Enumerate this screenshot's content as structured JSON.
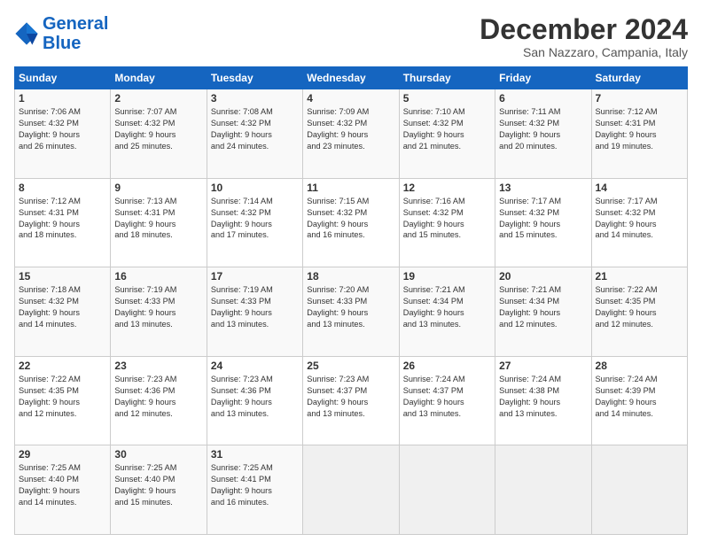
{
  "logo": {
    "line1": "General",
    "line2": "Blue"
  },
  "title": "December 2024",
  "subtitle": "San Nazzaro, Campania, Italy",
  "days_header": [
    "Sunday",
    "Monday",
    "Tuesday",
    "Wednesday",
    "Thursday",
    "Friday",
    "Saturday"
  ],
  "weeks": [
    [
      {
        "day": "1",
        "info": "Sunrise: 7:06 AM\nSunset: 4:32 PM\nDaylight: 9 hours\nand 26 minutes."
      },
      {
        "day": "2",
        "info": "Sunrise: 7:07 AM\nSunset: 4:32 PM\nDaylight: 9 hours\nand 25 minutes."
      },
      {
        "day": "3",
        "info": "Sunrise: 7:08 AM\nSunset: 4:32 PM\nDaylight: 9 hours\nand 24 minutes."
      },
      {
        "day": "4",
        "info": "Sunrise: 7:09 AM\nSunset: 4:32 PM\nDaylight: 9 hours\nand 23 minutes."
      },
      {
        "day": "5",
        "info": "Sunrise: 7:10 AM\nSunset: 4:32 PM\nDaylight: 9 hours\nand 21 minutes."
      },
      {
        "day": "6",
        "info": "Sunrise: 7:11 AM\nSunset: 4:32 PM\nDaylight: 9 hours\nand 20 minutes."
      },
      {
        "day": "7",
        "info": "Sunrise: 7:12 AM\nSunset: 4:31 PM\nDaylight: 9 hours\nand 19 minutes."
      }
    ],
    [
      {
        "day": "8",
        "info": "Sunrise: 7:12 AM\nSunset: 4:31 PM\nDaylight: 9 hours\nand 18 minutes."
      },
      {
        "day": "9",
        "info": "Sunrise: 7:13 AM\nSunset: 4:31 PM\nDaylight: 9 hours\nand 18 minutes."
      },
      {
        "day": "10",
        "info": "Sunrise: 7:14 AM\nSunset: 4:32 PM\nDaylight: 9 hours\nand 17 minutes."
      },
      {
        "day": "11",
        "info": "Sunrise: 7:15 AM\nSunset: 4:32 PM\nDaylight: 9 hours\nand 16 minutes."
      },
      {
        "day": "12",
        "info": "Sunrise: 7:16 AM\nSunset: 4:32 PM\nDaylight: 9 hours\nand 15 minutes."
      },
      {
        "day": "13",
        "info": "Sunrise: 7:17 AM\nSunset: 4:32 PM\nDaylight: 9 hours\nand 15 minutes."
      },
      {
        "day": "14",
        "info": "Sunrise: 7:17 AM\nSunset: 4:32 PM\nDaylight: 9 hours\nand 14 minutes."
      }
    ],
    [
      {
        "day": "15",
        "info": "Sunrise: 7:18 AM\nSunset: 4:32 PM\nDaylight: 9 hours\nand 14 minutes."
      },
      {
        "day": "16",
        "info": "Sunrise: 7:19 AM\nSunset: 4:33 PM\nDaylight: 9 hours\nand 13 minutes."
      },
      {
        "day": "17",
        "info": "Sunrise: 7:19 AM\nSunset: 4:33 PM\nDaylight: 9 hours\nand 13 minutes."
      },
      {
        "day": "18",
        "info": "Sunrise: 7:20 AM\nSunset: 4:33 PM\nDaylight: 9 hours\nand 13 minutes."
      },
      {
        "day": "19",
        "info": "Sunrise: 7:21 AM\nSunset: 4:34 PM\nDaylight: 9 hours\nand 13 minutes."
      },
      {
        "day": "20",
        "info": "Sunrise: 7:21 AM\nSunset: 4:34 PM\nDaylight: 9 hours\nand 12 minutes."
      },
      {
        "day": "21",
        "info": "Sunrise: 7:22 AM\nSunset: 4:35 PM\nDaylight: 9 hours\nand 12 minutes."
      }
    ],
    [
      {
        "day": "22",
        "info": "Sunrise: 7:22 AM\nSunset: 4:35 PM\nDaylight: 9 hours\nand 12 minutes."
      },
      {
        "day": "23",
        "info": "Sunrise: 7:23 AM\nSunset: 4:36 PM\nDaylight: 9 hours\nand 12 minutes."
      },
      {
        "day": "24",
        "info": "Sunrise: 7:23 AM\nSunset: 4:36 PM\nDaylight: 9 hours\nand 13 minutes."
      },
      {
        "day": "25",
        "info": "Sunrise: 7:23 AM\nSunset: 4:37 PM\nDaylight: 9 hours\nand 13 minutes."
      },
      {
        "day": "26",
        "info": "Sunrise: 7:24 AM\nSunset: 4:37 PM\nDaylight: 9 hours\nand 13 minutes."
      },
      {
        "day": "27",
        "info": "Sunrise: 7:24 AM\nSunset: 4:38 PM\nDaylight: 9 hours\nand 13 minutes."
      },
      {
        "day": "28",
        "info": "Sunrise: 7:24 AM\nSunset: 4:39 PM\nDaylight: 9 hours\nand 14 minutes."
      }
    ],
    [
      {
        "day": "29",
        "info": "Sunrise: 7:25 AM\nSunset: 4:40 PM\nDaylight: 9 hours\nand 14 minutes."
      },
      {
        "day": "30",
        "info": "Sunrise: 7:25 AM\nSunset: 4:40 PM\nDaylight: 9 hours\nand 15 minutes."
      },
      {
        "day": "31",
        "info": "Sunrise: 7:25 AM\nSunset: 4:41 PM\nDaylight: 9 hours\nand 16 minutes."
      },
      {
        "day": "",
        "info": ""
      },
      {
        "day": "",
        "info": ""
      },
      {
        "day": "",
        "info": ""
      },
      {
        "day": "",
        "info": ""
      }
    ]
  ]
}
